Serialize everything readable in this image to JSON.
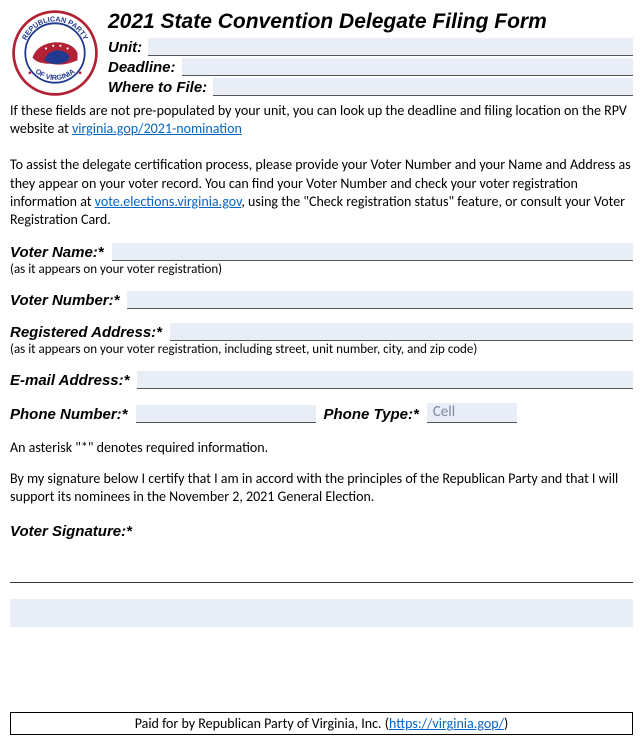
{
  "title": "2021 State Convention Delegate Filing Form",
  "header": {
    "unit_label": "Unit:",
    "deadline_label": "Deadline:",
    "where_label": "Where to File:"
  },
  "note": {
    "prefix": "If these fields are not pre-populated by your unit, you can look up the deadline and filing location on the RPV website at ",
    "link_text": "virginia.gop/2021-nomination"
  },
  "instructions": {
    "prefix": "To assist the delegate certification process, please provide your Voter Number and your Name and Address as they appear on your voter record. You can find your Voter Number and check your voter registration information at ",
    "link_text": "vote.elections.virginia.gov",
    "suffix": ", using the \"Check registration status\" feature, or consult your Voter Registration Card."
  },
  "fields": {
    "voter_name_label": "Voter Name:*",
    "voter_name_sub": "(as it appears on your voter registration)",
    "voter_number_label": "Voter Number:*",
    "address_label": "Registered Address:*",
    "address_sub": "(as it appears on your voter registration, including street, unit number, city, and zip code)",
    "email_label": "E-mail Address:*",
    "phone_label": "Phone Number:*",
    "phone_type_label": "Phone Type:*",
    "phone_type_value": "Cell"
  },
  "asterisk_note": "An asterisk \"*\" denotes required information.",
  "certification": "By my signature below I certify that I am in accord with the principles of the Republican Party and that I will support its nominees in the November 2, 2021 General Election.",
  "signature_label": "Voter Signature:*",
  "footer": {
    "prefix": "Paid for by Republican Party of Virginia, Inc. (",
    "link_text": "https://virginia.gop/",
    "suffix": ")"
  },
  "logo": {
    "outer_text_top": "REPUBLICAN PARTY",
    "outer_text_bottom": "OF VIRGINIA"
  }
}
